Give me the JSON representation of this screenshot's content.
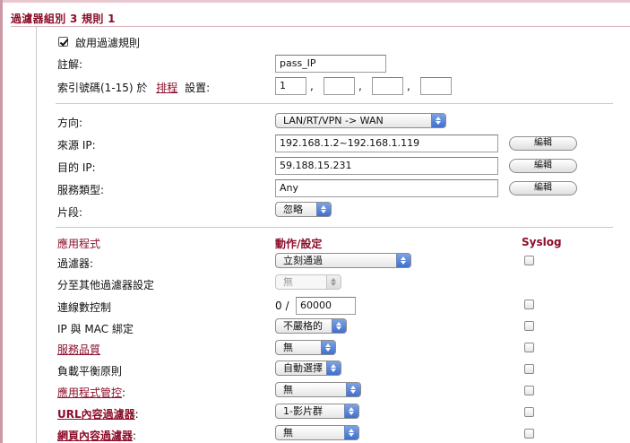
{
  "title": "過濾器組別 3 規則 1",
  "enable_rule": {
    "label": "啟用過濾規則",
    "checked": true
  },
  "comment": {
    "label": "註解:",
    "value": "pass_IP"
  },
  "index": {
    "label_prefix": "索引號碼(1-15) 於",
    "schedule_link": "排程",
    "label_suffix": "設置:",
    "values": [
      "1",
      "",
      "",
      ""
    ],
    "separator": ","
  },
  "direction": {
    "label": "方向:",
    "value": "LAN/RT/VPN -> WAN"
  },
  "source_ip": {
    "label": "來源 IP:",
    "value": "192.168.1.2~192.168.1.119",
    "edit_label": "編輯"
  },
  "dest_ip": {
    "label": "目的 IP:",
    "value": "59.188.15.231",
    "edit_label": "編輯"
  },
  "service_type": {
    "label": "服務類型:",
    "value": "Any",
    "edit_label": "編輯"
  },
  "fragment": {
    "label": "片段:",
    "value": "忽略"
  },
  "app_section": {
    "header_app": "應用程式",
    "header_action": "動作/設定",
    "header_syslog": "Syslog"
  },
  "rows": {
    "filter": {
      "label": "過濾器:",
      "value": "立刻通過"
    },
    "branch": {
      "label": "分至其他過濾器設定",
      "value": "無"
    },
    "session": {
      "label": "連線數控制",
      "prefix": "0 /",
      "value": "60000"
    },
    "ipmac": {
      "label": "IP 與 MAC 綁定",
      "value": "不嚴格的"
    },
    "qos": {
      "label": "服務品質",
      "value": "無"
    },
    "lb": {
      "label": "負載平衡原則",
      "value": "自動選擇"
    },
    "appctrl": {
      "label": "應用程式管控",
      "suffix": ":",
      "value": "無"
    },
    "url": {
      "label": "URL內容過濾器",
      "suffix": ":",
      "value": "1-影片群"
    },
    "web": {
      "label": "網頁內容過濾器",
      "suffix": ":",
      "value": "無"
    }
  }
}
